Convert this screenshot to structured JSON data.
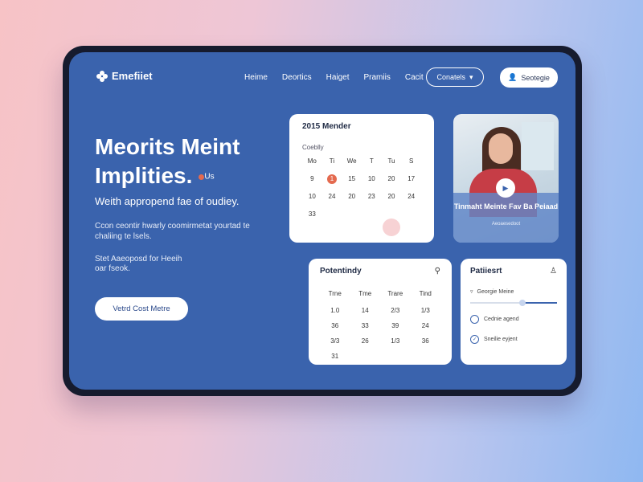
{
  "brand": {
    "name": "Emefiiet"
  },
  "nav": {
    "items": [
      "Heime",
      "Deortics",
      "Haiget",
      "Pramiis",
      "Cacit"
    ],
    "contact_label": "Conatels",
    "signin_label": "Seotegie"
  },
  "hero": {
    "title_line1": "Meorits Meint",
    "title_line2": "Implities.",
    "badge": "Us",
    "subtitle": "Weith appropend fae of oudiey.",
    "description": "Ccon ceontir hwarly coomirmetat yourtad te chaliing te lsels.",
    "extra": "Stet Aaeoposd for Heeih oar fseok.",
    "cta_label": "Vetrd Cost Metre"
  },
  "calendar": {
    "title": "2015 Mender",
    "month": "Coeblly",
    "weekdays": [
      "Mo",
      "Ti",
      "We",
      "T",
      "Tu",
      "S"
    ],
    "days": [
      "9",
      "1",
      "15",
      "10",
      "20",
      "17",
      "10",
      "24",
      "20",
      "23",
      "20",
      "24",
      "33"
    ],
    "today": "1"
  },
  "video": {
    "title": "Tinmaht Meinte Fav Ba Peiaad",
    "subtitle": "Aeoaesedoot"
  },
  "activity": {
    "title": "Potentindy",
    "columns": [
      "Trne",
      "Tme",
      "Trare",
      "Tind"
    ],
    "rows": [
      [
        "1.0",
        "14",
        "2/3",
        "1/3"
      ],
      [
        "36",
        "33",
        "39",
        "24"
      ],
      [
        "3/3",
        "26",
        "1/3",
        "36"
      ],
      [
        "31",
        "",
        "",
        ""
      ]
    ]
  },
  "patient": {
    "title": "Patiiesrt",
    "filter_label": "Georgie Meine",
    "slider_value": 0.6,
    "options": [
      "Cednie agend",
      "Sneilie eyjent"
    ]
  }
}
